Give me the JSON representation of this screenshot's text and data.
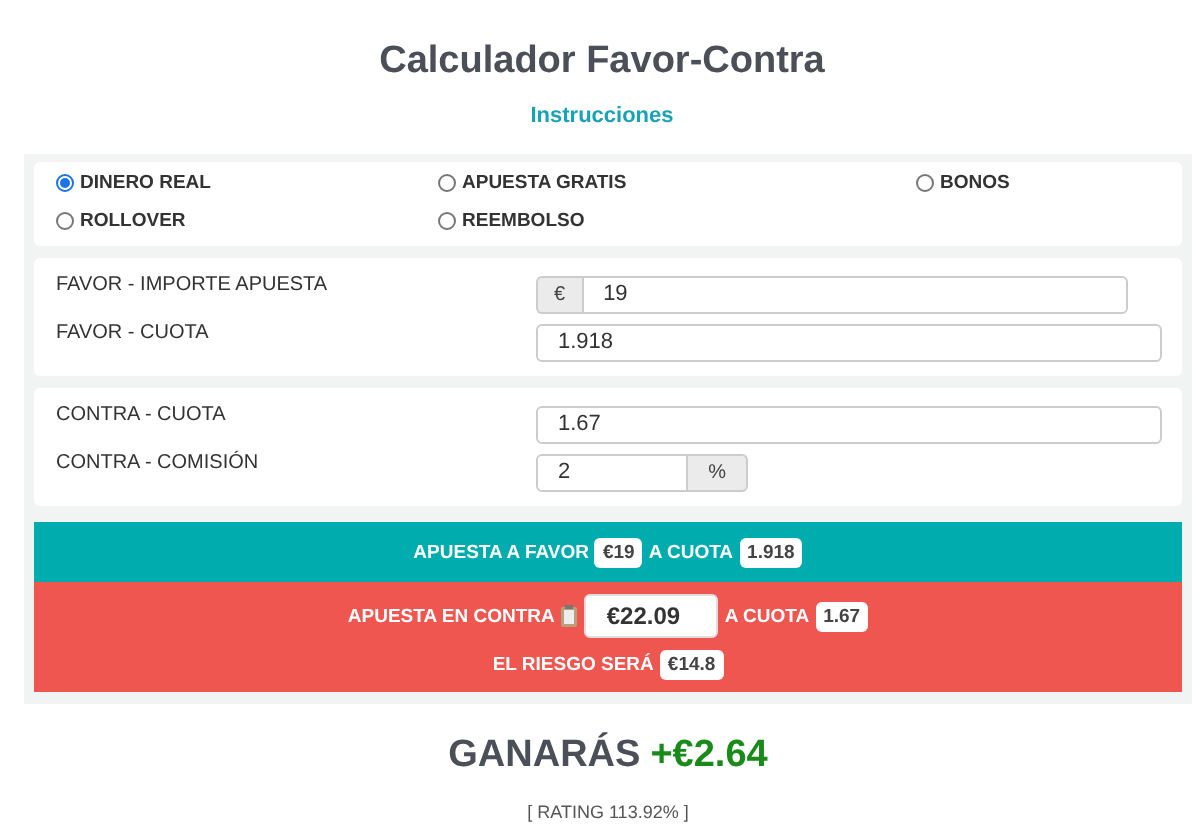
{
  "title": "Calculador Favor-Contra",
  "link": "Instrucciones",
  "modes": [
    {
      "label": "DINERO REAL",
      "selected": true
    },
    {
      "label": "APUESTA GRATIS",
      "selected": false
    },
    {
      "label": "BONOS",
      "selected": false
    },
    {
      "label": "ROLLOVER",
      "selected": false
    },
    {
      "label": "REEMBOLSO",
      "selected": false
    }
  ],
  "favor": [
    {
      "label": "FAVOR - IMPORTE APUESTA",
      "prefix": "€",
      "value": "19"
    },
    {
      "label": "FAVOR - CUOTA",
      "value": "1.918"
    }
  ],
  "contra": [
    {
      "label": "CONTRA - CUOTA",
      "value": "1.67"
    },
    {
      "label": "CONTRA - COMISIÓN",
      "value": "2",
      "suffix": "%"
    }
  ],
  "favor_bar": {
    "text1": "APUESTA A FAVOR",
    "stake": "€19",
    "text2": "A CUOTA",
    "odds": "1.918"
  },
  "contra_bar": {
    "text1": "APUESTA EN CONTRA",
    "stake": "€22.09",
    "text2": "A CUOTA",
    "odds": "1.67",
    "risk_label": "EL RIESGO SERÁ",
    "risk": "€14.8"
  },
  "result": {
    "label": "GANARÁS",
    "amount": "+€2.64",
    "rating": "[ RATING 113.92% ]"
  }
}
